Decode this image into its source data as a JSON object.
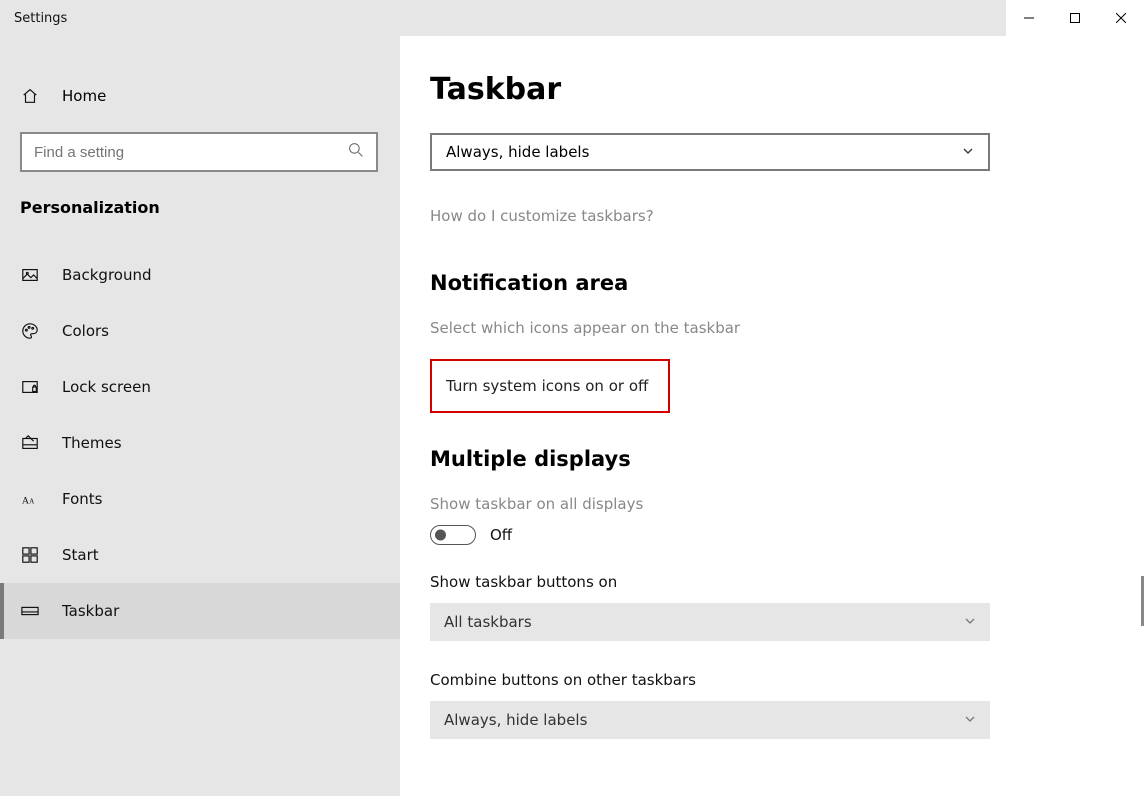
{
  "window": {
    "title": "Settings"
  },
  "sidebar": {
    "home_label": "Home",
    "search_placeholder": "Find a setting",
    "section_title": "Personalization",
    "items": [
      {
        "id": "background",
        "label": "Background"
      },
      {
        "id": "colors",
        "label": "Colors"
      },
      {
        "id": "lockscreen",
        "label": "Lock screen"
      },
      {
        "id": "themes",
        "label": "Themes"
      },
      {
        "id": "fonts",
        "label": "Fonts"
      },
      {
        "id": "start",
        "label": "Start"
      },
      {
        "id": "taskbar",
        "label": "Taskbar"
      }
    ]
  },
  "content": {
    "page_title": "Taskbar",
    "combine_dropdown": "Always, hide labels",
    "help_link": "How do I customize taskbars?",
    "notification": {
      "heading": "Notification area",
      "select_icons_link": "Select which icons appear on the taskbar",
      "system_icons_link": "Turn system icons on or off"
    },
    "multiple_displays": {
      "heading": "Multiple displays",
      "show_all_label": "Show taskbar on all displays",
      "show_all_state": "Off",
      "show_buttons_label": "Show taskbar buttons on",
      "show_buttons_value": "All taskbars",
      "combine_other_label": "Combine buttons on other taskbars",
      "combine_other_value": "Always, hide labels"
    }
  }
}
